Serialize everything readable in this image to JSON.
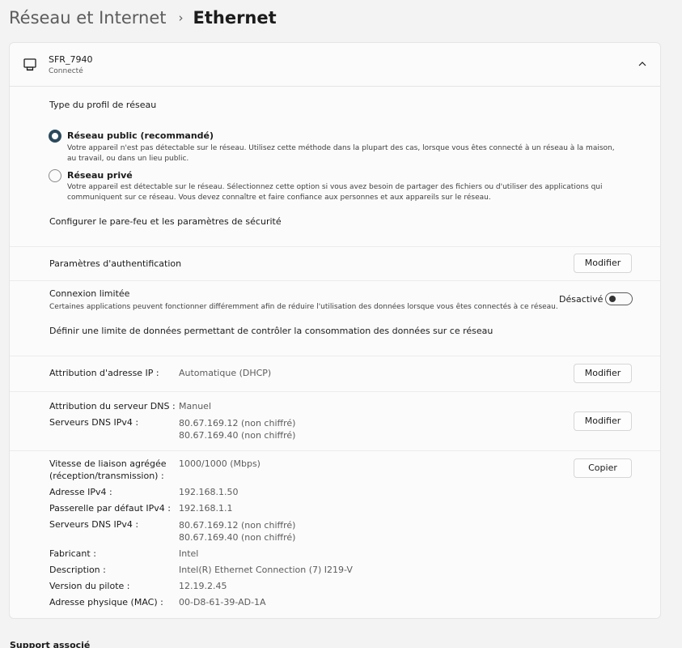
{
  "breadcrumb": {
    "parent": "Réseau et Internet",
    "separator": "›",
    "current": "Ethernet"
  },
  "connection": {
    "name": "SFR_7940",
    "status": "Connecté",
    "icon": "ethernet-icon",
    "expand_icon": "chevron-up-icon"
  },
  "profile": {
    "title": "Type du profil de réseau",
    "public": {
      "label": "Réseau public (recommandé)",
      "description": "Votre appareil n'est pas détectable sur le réseau. Utilisez cette méthode dans la plupart des cas, lorsque vous êtes connecté à un réseau à la maison, au travail, ou dans un lieu public.",
      "selected": true
    },
    "private": {
      "label": "Réseau privé",
      "description": "Votre appareil est détectable sur le réseau. Sélectionnez cette option si vous avez besoin de partager des fichiers ou d'utiliser des applications qui communiquent sur ce réseau. Vous devez connaître et faire confiance aux personnes et aux appareils sur le réseau.",
      "selected": false
    },
    "firewall_link": "Configurer le pare-feu et les paramètres de sécurité"
  },
  "auth": {
    "label": "Paramètres d'authentification",
    "button": "Modifier"
  },
  "metered": {
    "label": "Connexion limitée",
    "description": "Certaines applications peuvent fonctionner différemment afin de réduire l'utilisation des données lorsque vous êtes connectés à ce réseau.",
    "toggle_label": "Désactivé",
    "toggle_on": false,
    "data_limit_link": "Définir une limite de données permettant de contrôler la consommation des données sur ce réseau"
  },
  "ip_assignment": {
    "label": "Attribution d'adresse IP :",
    "value": "Automatique (DHCP)",
    "button": "Modifier"
  },
  "dns": {
    "assign_label": "Attribution du serveur DNS :",
    "assign_value": "Manuel",
    "servers_label": "Serveurs DNS IPv4 :",
    "server1": "80.67.169.12 (non chiffré)",
    "server2": "80.67.169.40 (non chiffré)",
    "button": "Modifier"
  },
  "properties": {
    "button": "Copier",
    "speed_label_1": "Vitesse de liaison agrégée",
    "speed_label_2": "(réception/transmission) :",
    "speed_value": "1000/1000 (Mbps)",
    "ipv4_label": "Adresse IPv4 :",
    "ipv4_value": "192.168.1.50",
    "gateway_label": "Passerelle par défaut IPv4 :",
    "gateway_value": "192.168.1.1",
    "dns_label": "Serveurs DNS IPv4 :",
    "dns_value_1": "80.67.169.12 (non chiffré)",
    "dns_value_2": "80.67.169.40 (non chiffré)",
    "manufacturer_label": "Fabricant :",
    "manufacturer_value": "Intel",
    "description_label": "Description :",
    "description_value": "Intel(R) Ethernet Connection (7) I219-V",
    "driver_label": "Version du pilote :",
    "driver_value": "12.19.2.45",
    "mac_label": "Adresse physique (MAC) :",
    "mac_value": "00-D8-61-39-AD-1A"
  },
  "footer": {
    "related_support": "Support associé"
  },
  "colors": {
    "accent": "#2a4a5c",
    "background": "#f3f3f3",
    "card": "#fbfbfb"
  }
}
